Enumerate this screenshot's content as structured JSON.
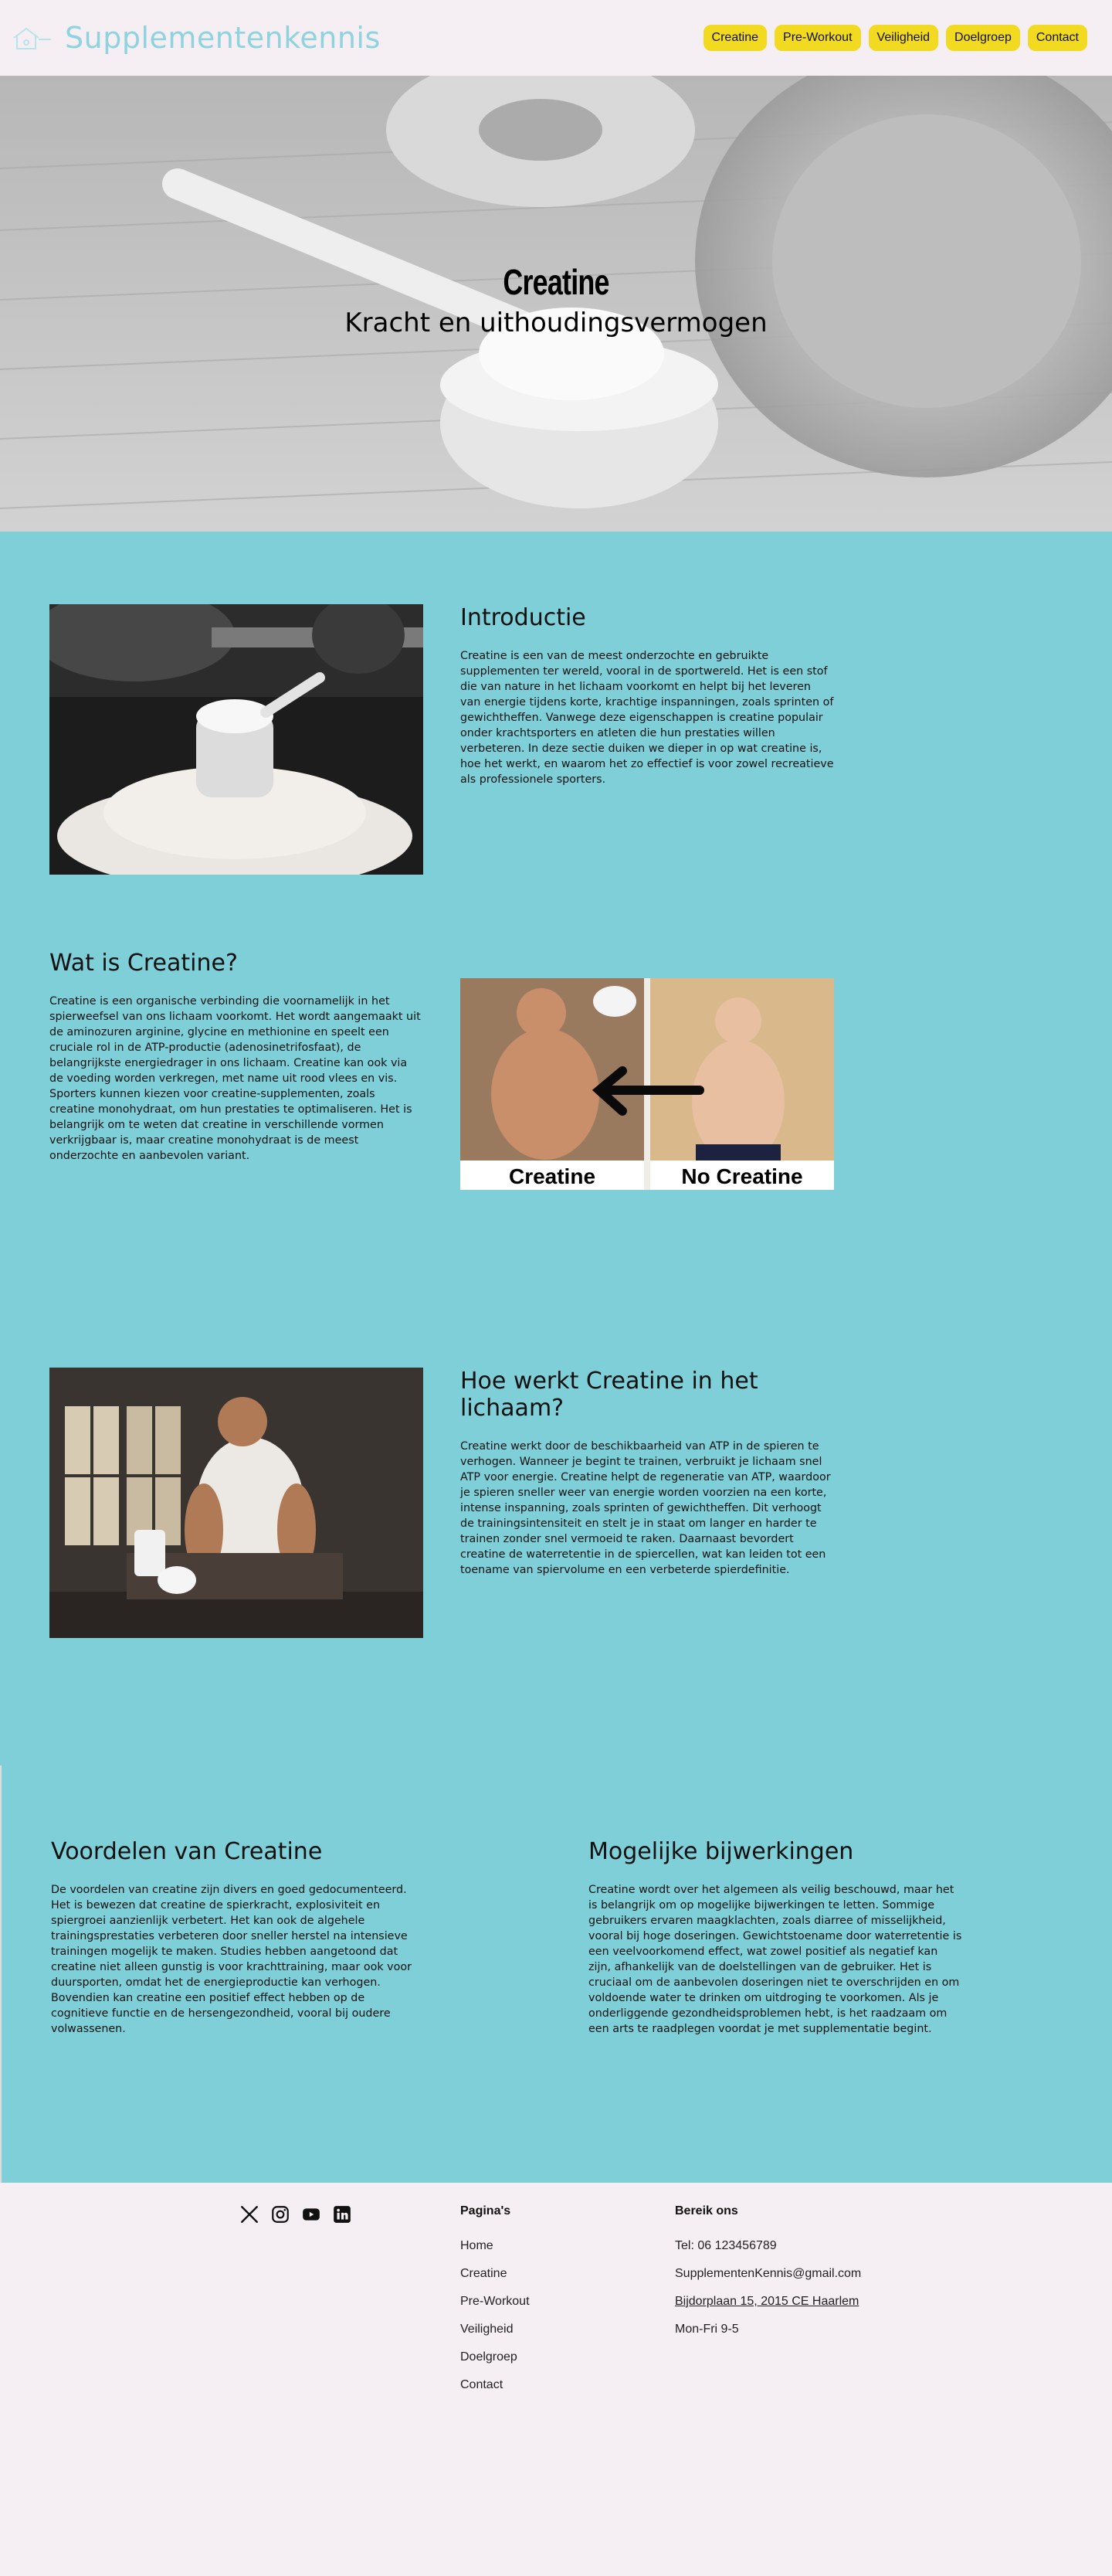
{
  "nav": {
    "brand": "Supplementenkennis",
    "links": [
      "Creatine",
      "Pre-Workout",
      "Veiligheid",
      "Doelgroep",
      "Contact"
    ]
  },
  "hero": {
    "title": "Creatine",
    "subtitle": "Kracht en uithoudingsvermogen"
  },
  "sections": {
    "intro": {
      "title": "Introductie",
      "text": "Creatine is een van de meest onderzochte en gebruikte supplementen ter wereld, vooral in de sportwereld. Het is een stof die van nature in het lichaam voorkomt en helpt bij het leveren van energie tijdens korte, krachtige inspanningen, zoals sprinten of gewichtheffen. Vanwege deze eigenschappen is creatine populair onder krachtsporters en atleten die hun prestaties willen verbeteren. In deze sectie duiken we dieper in op wat creatine is, hoe het werkt, en waarom het zo effectief is voor zowel recreatieve als professionele sporters."
    },
    "what": {
      "title": "Wat is Creatine?",
      "text": "Creatine is een organische verbinding die voornamelijk in het spierweefsel van ons lichaam voorkomt. Het wordt aangemaakt uit de aminozuren arginine, glycine en methionine en speelt een cruciale rol in de ATP-productie (adenosinetrifosfaat), de belangrijkste energiedrager in ons lichaam. Creatine kan ook via de voeding worden verkregen, met name uit rood vlees en vis. Sporters kunnen kiezen voor creatine-supplementen, zoals creatine monohydraat, om hun prestaties te optimaliseren. Het is belangrijk om te weten dat creatine in verschillende vormen verkrijgbaar is, maar creatine monohydraat is de meest onderzochte en aanbevolen variant.",
      "img_left": "Creatine",
      "img_right": "No Creatine"
    },
    "how": {
      "title": "Hoe werkt Creatine in het lichaam?",
      "text": "Creatine werkt door de beschikbaarheid van ATP in de spieren te verhogen. Wanneer je begint te trainen, verbruikt je lichaam snel ATP voor energie. Creatine helpt de regeneratie van ATP, waardoor je spieren sneller weer van energie worden voorzien na een korte, intense inspanning, zoals sprinten of gewichtheffen. Dit verhoogt de trainingsintensiteit en stelt je in staat om langer en harder te trainen zonder snel vermoeid te raken. Daarnaast bevordert creatine de waterretentie in de spiercellen, wat kan leiden tot een toename van spiervolume en een verbeterde spierdefinitie."
    },
    "benefits": {
      "title": "Voordelen van Creatine",
      "text": "De voordelen van creatine zijn divers en goed gedocumenteerd. Het is bewezen dat creatine de spierkracht, explosiviteit en spiergroei aanzienlijk verbetert. Het kan ook de algehele trainingsprestaties verbeteren door sneller herstel na intensieve trainingen mogelijk te maken. Studies hebben aangetoond dat creatine niet alleen gunstig is voor krachttraining, maar ook voor duursporten, omdat het de energieproductie kan verhogen. Bovendien kan creatine een positief effect hebben op de cognitieve functie en de hersengezondheid, vooral bij oudere volwassenen."
    },
    "sideeffects": {
      "title": "Mogelijke bijwerkingen",
      "text": "Creatine wordt over het algemeen als veilig beschouwd, maar het is belangrijk om op mogelijke bijwerkingen te letten. Sommige gebruikers ervaren maagklachten, zoals diarree of misselijkheid, vooral bij hoge doseringen. Gewichtstoename door waterretentie is een veelvoorkomend effect, wat zowel positief als negatief kan zijn, afhankelijk van de doelstellingen van de gebruiker. Het is cruciaal om de aanbevolen doseringen niet te overschrijden en om voldoende water te drinken om uitdroging te voorkomen. Als je onderliggende gezondheidsproblemen hebt, is het raadzaam om een arts te raadplegen voordat je met supplementatie begint."
    }
  },
  "footer": {
    "pages_title": "Pagina's",
    "pages": [
      "Home",
      "Creatine",
      "Pre-Workout",
      "Veiligheid",
      "Doelgroep",
      "Contact"
    ],
    "contact_title": "Bereik ons",
    "phone": "Tel: 06 123456789",
    "email": "SupplementenKennis@gmail.com",
    "address": "Bijdorplaan 15, 2015 CE Haarlem",
    "hours": "Mon-Fri 9-5"
  },
  "icons": {
    "brand": "house-icon",
    "social": [
      "x-icon",
      "instagram-icon",
      "youtube-icon",
      "linkedin-icon"
    ]
  },
  "colors": {
    "accent_yellow": "#f1da1f",
    "teal": "#7ecfd8",
    "background": "#f5eef2",
    "brand_text": "#8fd3de"
  }
}
